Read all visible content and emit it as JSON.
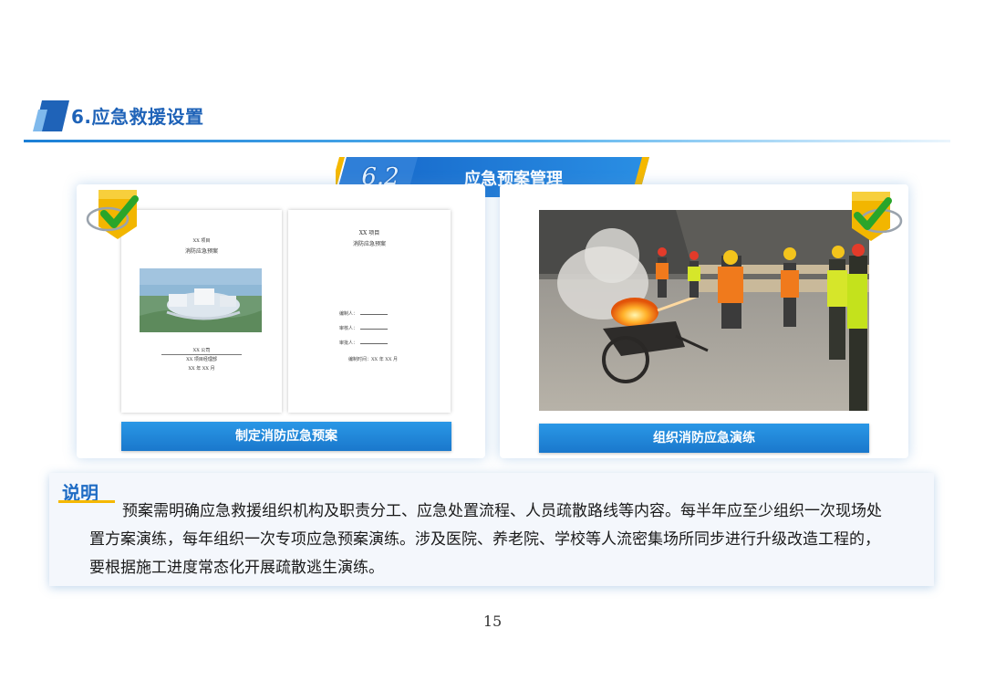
{
  "section": {
    "title": "6.应急救援设置"
  },
  "banner": {
    "number": "6.2",
    "label": "应急预案管理"
  },
  "left_panel": {
    "caption": "制定消防应急预案",
    "cover_page": {
      "project": "XX 项目",
      "title": "消防应急预案",
      "company": "XX 公司",
      "dept": "XX 项目经理部",
      "date": "XX 年 XX 月"
    },
    "form_page": {
      "project": "XX 项目",
      "title": "消防应急预案",
      "fields": [
        "编制人：",
        "审核人：",
        "审批人："
      ],
      "date_line": "编制时间：XX 年 XX 月"
    }
  },
  "right_panel": {
    "caption": "组织消防应急演练"
  },
  "note": {
    "heading": "说明",
    "text": "预案需明确应急救援组织机构及职责分工、应急处置流程、人员疏散路线等内容。每半年应至少组织一次现场处置方案演练，每年组织一次专项应急预案演练。涉及医院、养老院、学校等人流密集场所同步进行升级改造工程的，要根据施工进度常态化开展疏散逃生演练。"
  },
  "page_number": "15",
  "colors": {
    "accent_blue": "#1f63b8",
    "caption_blue": "#1a78cc",
    "badge_gold": "#f2b600",
    "check_green": "#2aa52a"
  },
  "icons": {
    "check_badge": "check-badge-icon",
    "section_marker": "section-marker-icon"
  }
}
